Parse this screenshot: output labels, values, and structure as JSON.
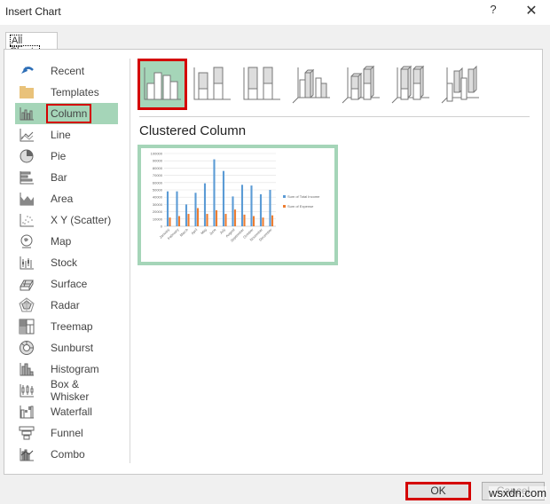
{
  "window": {
    "title": "Insert Chart",
    "help_glyph": "?",
    "close_glyph": "✕"
  },
  "tabs": [
    {
      "label": "All Charts",
      "selected": true
    }
  ],
  "sidebar": {
    "selected": "Column",
    "items": [
      {
        "label": "Recent",
        "icon": "recent-icon"
      },
      {
        "label": "Templates",
        "icon": "folder-icon"
      },
      {
        "label": "Column",
        "icon": "column-chart-icon"
      },
      {
        "label": "Line",
        "icon": "line-chart-icon"
      },
      {
        "label": "Pie",
        "icon": "pie-chart-icon"
      },
      {
        "label": "Bar",
        "icon": "bar-chart-icon"
      },
      {
        "label": "Area",
        "icon": "area-chart-icon"
      },
      {
        "label": "X Y (Scatter)",
        "icon": "scatter-chart-icon"
      },
      {
        "label": "Map",
        "icon": "map-chart-icon"
      },
      {
        "label": "Stock",
        "icon": "stock-chart-icon"
      },
      {
        "label": "Surface",
        "icon": "surface-chart-icon"
      },
      {
        "label": "Radar",
        "icon": "radar-chart-icon"
      },
      {
        "label": "Treemap",
        "icon": "treemap-chart-icon"
      },
      {
        "label": "Sunburst",
        "icon": "sunburst-chart-icon"
      },
      {
        "label": "Histogram",
        "icon": "histogram-chart-icon"
      },
      {
        "label": "Box & Whisker",
        "icon": "box-whisker-chart-icon"
      },
      {
        "label": "Waterfall",
        "icon": "waterfall-chart-icon"
      },
      {
        "label": "Funnel",
        "icon": "funnel-chart-icon"
      },
      {
        "label": "Combo",
        "icon": "combo-chart-icon"
      }
    ]
  },
  "subtypes": [
    {
      "name": "Clustered Column",
      "selected": true
    },
    {
      "name": "Stacked Column"
    },
    {
      "name": "100% Stacked Column"
    },
    {
      "name": "3-D Clustered Column"
    },
    {
      "name": "3-D Stacked Column"
    },
    {
      "name": "3-D 100% Stacked Column"
    },
    {
      "name": "3-D Column"
    }
  ],
  "subtype_title": "Clustered Column",
  "buttons": {
    "ok": "OK",
    "cancel": "Cancel"
  },
  "watermark": "wsxdn.com",
  "colors": {
    "selected_bg": "#a5d5b8",
    "highlight": "#d40000",
    "income": "#5b9bd5",
    "expense": "#ed7d31"
  },
  "chart_data": {
    "type": "bar",
    "categories": [
      "January",
      "February",
      "March",
      "April",
      "May",
      "June",
      "July",
      "August",
      "September",
      "October",
      "November",
      "December"
    ],
    "series": [
      {
        "name": "Sum of Total Income",
        "values": [
          48000,
          48000,
          30000,
          46000,
          59000,
          92000,
          76000,
          41000,
          57000,
          56000,
          44000,
          50000
        ]
      },
      {
        "name": "Sum of Expense",
        "values": [
          12000,
          14000,
          17000,
          25000,
          17000,
          22000,
          17000,
          23000,
          16000,
          14000,
          12000,
          15000
        ]
      }
    ],
    "yticks": [
      "0",
      "10000",
      "20000",
      "30000",
      "40000",
      "50000",
      "60000",
      "70000",
      "80000",
      "90000",
      "100000"
    ],
    "ylim": [
      0,
      100000
    ],
    "grid": true,
    "legend": "right",
    "title": "",
    "xlabel": "",
    "ylabel": ""
  }
}
